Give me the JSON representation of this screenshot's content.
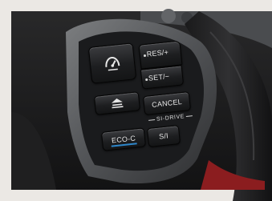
{
  "scene": {
    "buttons": {
      "res_label": "RES/+",
      "set_label": "SET/−",
      "cancel_label": "CANCEL",
      "eco_label": "ECO-C",
      "si_label": "S/I",
      "si_drive_label": "SI-DRIVE"
    },
    "icons": {
      "cruise": "cruise-control-icon",
      "distance": "following-distance-icon"
    },
    "colors": {
      "eco_accent": "#2e86c9"
    }
  }
}
